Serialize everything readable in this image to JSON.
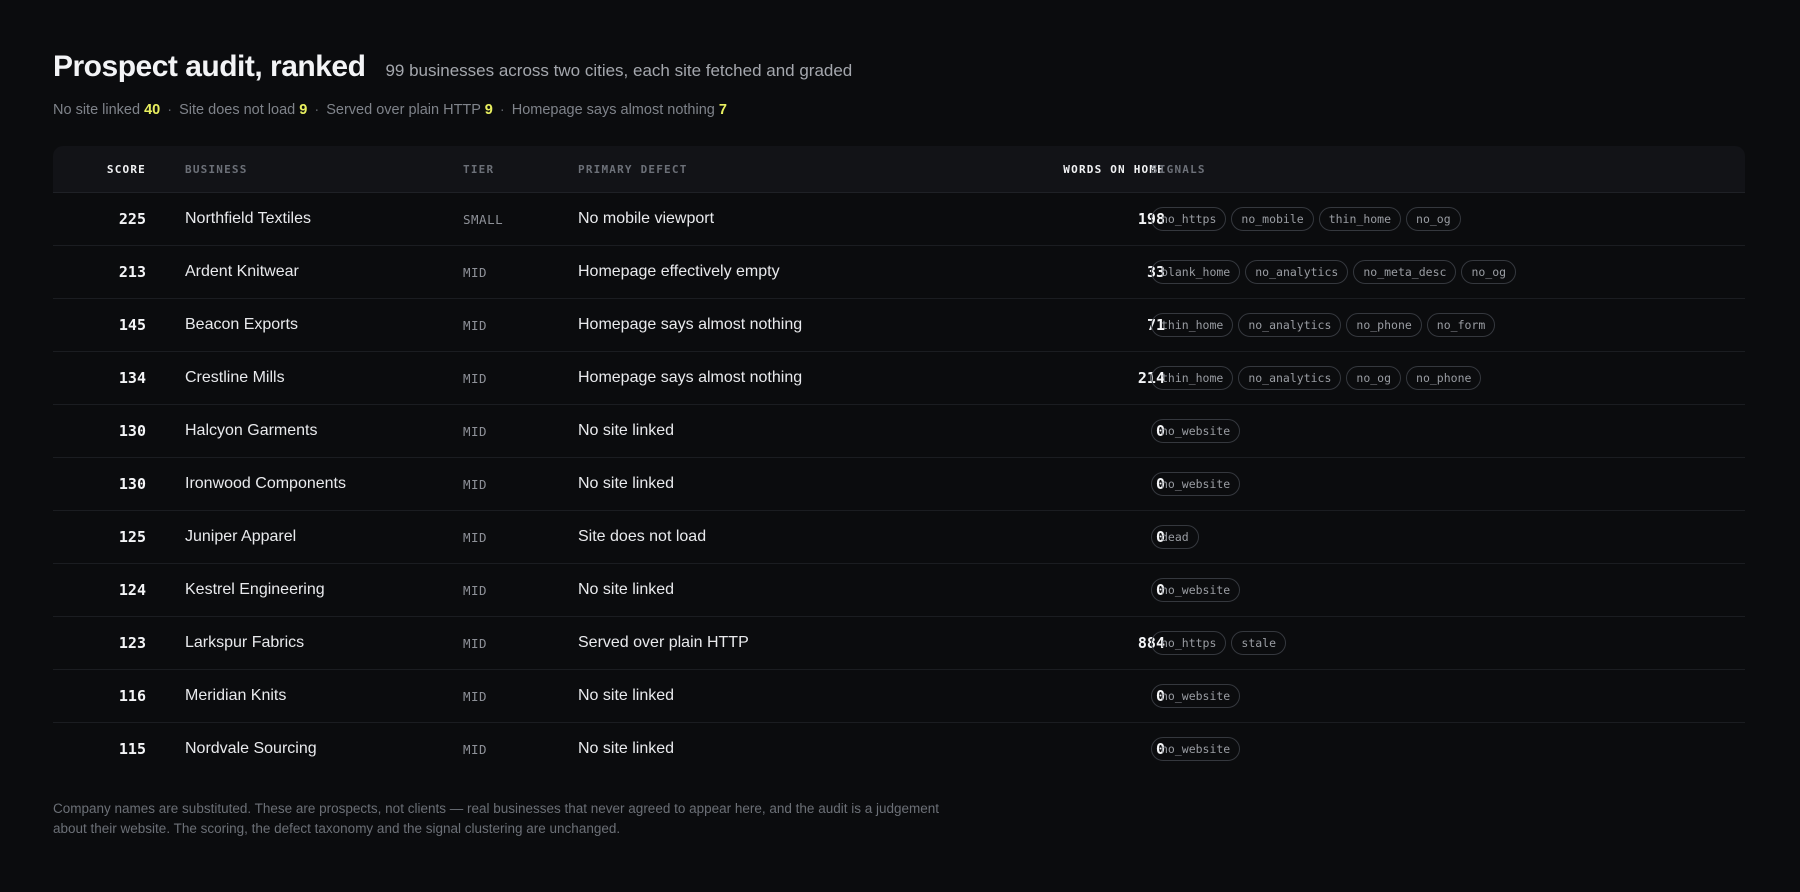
{
  "header": {
    "title": "Prospect audit, ranked",
    "subtitle": "99 businesses across two cities, each site fetched and graded"
  },
  "stats": [
    {
      "label": "No site linked",
      "value": "40"
    },
    {
      "label": "Site does not load",
      "value": "9"
    },
    {
      "label": "Served over plain HTTP",
      "value": "9"
    },
    {
      "label": "Homepage says almost nothing",
      "value": "7"
    }
  ],
  "stats_separator": "·",
  "table": {
    "columns": {
      "score": "SCORE",
      "business": "BUSINESS",
      "tier": "TIER",
      "defect": "PRIMARY DEFECT",
      "words": "WORDS ON HOME",
      "signals": "SIGNALS"
    },
    "rows": [
      {
        "score": "225",
        "business": "Northfield Textiles",
        "tier": "SMALL",
        "defect": "No mobile viewport",
        "words": "198",
        "signals": [
          "no_https",
          "no_mobile",
          "thin_home",
          "no_og"
        ]
      },
      {
        "score": "213",
        "business": "Ardent Knitwear",
        "tier": "MID",
        "defect": "Homepage effectively empty",
        "words": "33",
        "signals": [
          "blank_home",
          "no_analytics",
          "no_meta_desc",
          "no_og"
        ]
      },
      {
        "score": "145",
        "business": "Beacon Exports",
        "tier": "MID",
        "defect": "Homepage says almost nothing",
        "words": "71",
        "signals": [
          "thin_home",
          "no_analytics",
          "no_phone",
          "no_form"
        ]
      },
      {
        "score": "134",
        "business": "Crestline Mills",
        "tier": "MID",
        "defect": "Homepage says almost nothing",
        "words": "214",
        "signals": [
          "thin_home",
          "no_analytics",
          "no_og",
          "no_phone"
        ]
      },
      {
        "score": "130",
        "business": "Halcyon Garments",
        "tier": "MID",
        "defect": "No site linked",
        "words": "0",
        "signals": [
          "no_website"
        ]
      },
      {
        "score": "130",
        "business": "Ironwood Components",
        "tier": "MID",
        "defect": "No site linked",
        "words": "0",
        "signals": [
          "no_website"
        ]
      },
      {
        "score": "125",
        "business": "Juniper Apparel",
        "tier": "MID",
        "defect": "Site does not load",
        "words": "0",
        "signals": [
          "dead"
        ]
      },
      {
        "score": "124",
        "business": "Kestrel Engineering",
        "tier": "MID",
        "defect": "No site linked",
        "words": "0",
        "signals": [
          "no_website"
        ]
      },
      {
        "score": "123",
        "business": "Larkspur Fabrics",
        "tier": "MID",
        "defect": "Served over plain HTTP",
        "words": "884",
        "signals": [
          "no_https",
          "stale"
        ]
      },
      {
        "score": "116",
        "business": "Meridian Knits",
        "tier": "MID",
        "defect": "No site linked",
        "words": "0",
        "signals": [
          "no_website"
        ]
      },
      {
        "score": "115",
        "business": "Nordvale Sourcing",
        "tier": "MID",
        "defect": "No site linked",
        "words": "0",
        "signals": [
          "no_website"
        ]
      }
    ]
  },
  "footnote": "Company names are substituted. These are prospects, not clients — real businesses that never agreed to appear here, and the audit is a judgement about their website. The scoring, the defect taxonomy and the signal clustering are unchanged.",
  "colors": {
    "background": "#0b0c0e",
    "accent": "#e8ef5f",
    "header_bg": "#121317"
  }
}
